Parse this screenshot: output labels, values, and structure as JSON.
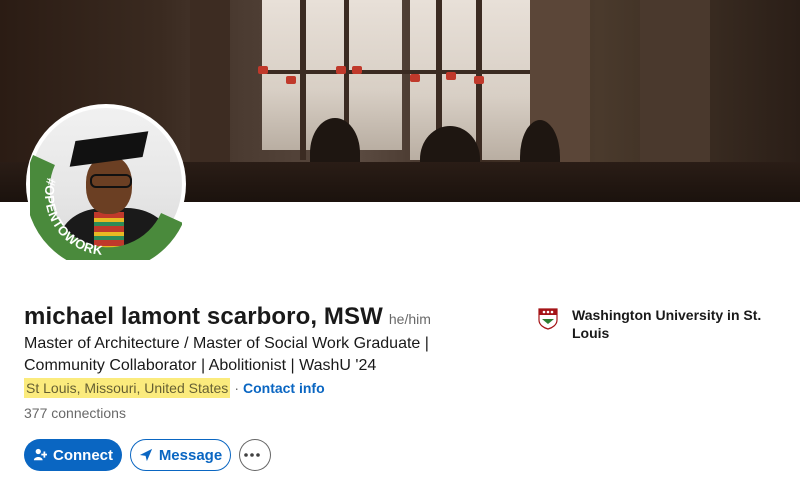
{
  "profile": {
    "name": "michael lamont scarboro, MSW",
    "pronouns": "he/him",
    "headline": "Master of Architecture / Master of Social Work Graduate | Community Collaborator | Abolitionist | WashU '24",
    "location": "St Louis, Missouri, United States",
    "separator": "·",
    "contact_info": "Contact info",
    "connections": "377 connections",
    "open_to_work_badge": "#OPENTOWORK"
  },
  "education": {
    "school": "Washington University in St. Louis",
    "logo_icon": "washu-shield-icon"
  },
  "actions": {
    "connect_label": "Connect",
    "message_label": "Message",
    "more_icon": "more-ellipsis-icon"
  },
  "colors": {
    "brand_blue": "#0a66c2",
    "open_to_work_green": "#4a8a3c",
    "highlight_yellow": "#fbeb7d"
  }
}
